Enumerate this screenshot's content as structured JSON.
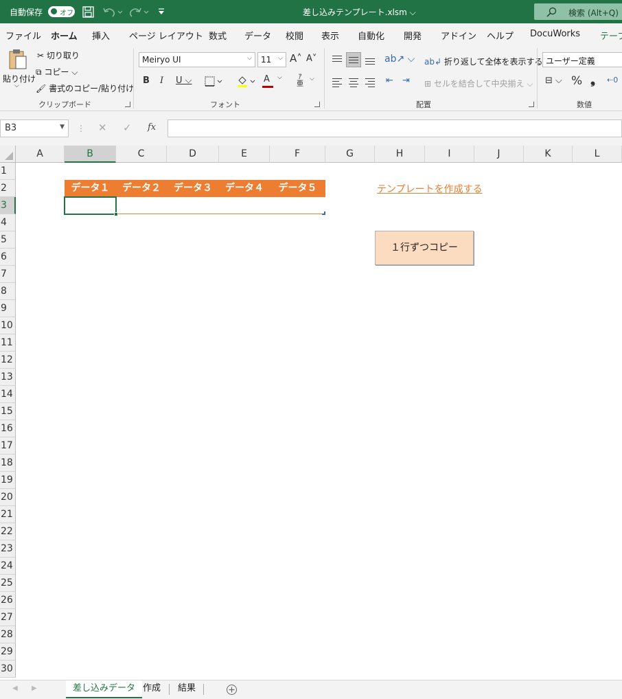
{
  "titlebar": {
    "autosave_label": "自動保存",
    "autosave_state": "オフ",
    "filename": "差し込みテンプレート.xlsm",
    "search_placeholder": "検索 (Alt+Q)"
  },
  "menu": {
    "tabs": [
      "ファイル",
      "ホーム",
      "挿入",
      "ページ レイアウト",
      "数式",
      "データ",
      "校閲",
      "表示",
      "自動化",
      "開発",
      "アドイン",
      "ヘルプ",
      "DocuWorks",
      "テーブ"
    ],
    "active": "ホーム"
  },
  "ribbon": {
    "clipboard": {
      "paste": "貼り付け",
      "cut": "切り取り",
      "copy": "コピー",
      "format_painter": "書式のコピー/貼り付け",
      "label": "クリップボード"
    },
    "font": {
      "name": "Meiryo UI",
      "size": "11",
      "label": "フォント"
    },
    "alignment": {
      "wrap": "折り返して全体を表示する",
      "merge": "セルを結合して中央揃え",
      "label": "配置"
    },
    "number": {
      "format": "ユーザー定義",
      "label": "数値"
    }
  },
  "formula": {
    "namebox": "B3",
    "content": ""
  },
  "grid": {
    "columns": [
      "A",
      "B",
      "C",
      "D",
      "E",
      "F",
      "G",
      "H",
      "I",
      "J",
      "K",
      "L"
    ],
    "rows": [
      "1",
      "2",
      "3",
      "4",
      "5",
      "6",
      "7",
      "8",
      "9",
      "10",
      "11",
      "12",
      "13",
      "14",
      "15",
      "16",
      "17",
      "18",
      "19",
      "20",
      "21",
      "22",
      "23",
      "24",
      "25",
      "26",
      "27",
      "28",
      "29",
      "30"
    ],
    "selected_column": "B",
    "selected_row": "3",
    "table_headers": [
      "データ１",
      "データ２",
      "データ３",
      "データ４",
      "データ５"
    ],
    "link_text": "テンプレートを作成する",
    "button_text": "１行ずつコピー"
  },
  "sheets": {
    "tabs": [
      "差し込みデータ",
      "作成",
      "結果"
    ],
    "active": "差し込みデータ"
  },
  "colors": {
    "excel_green": "#217346",
    "table_orange": "#ed7d31",
    "button_peach": "#fcdcc0"
  }
}
